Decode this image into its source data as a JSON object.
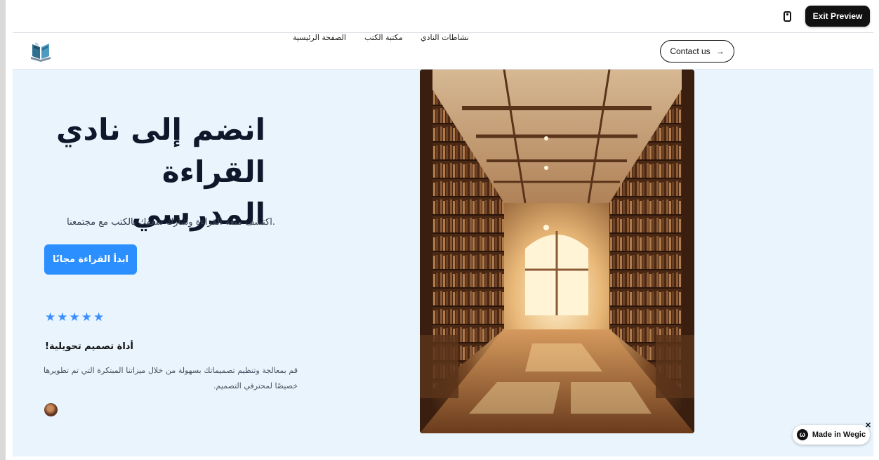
{
  "preview_bar": {
    "device_icon": "mobile-device-icon",
    "exit_label": "Exit Preview"
  },
  "nav": {
    "logo_icon": "open-book-logo",
    "links": [
      {
        "label": "الصفحة الرئيسية"
      },
      {
        "label": "مكتبة الكتب"
      },
      {
        "label": "نشاطات النادي"
      }
    ],
    "contact_label": "Contact us",
    "contact_arrow": "→"
  },
  "hero": {
    "title_line1": "انضم إلى نادي",
    "title_line2": "القراءة المدرسي",
    "subtitle": ".اكتشف متعة القراءة وشارك شغفك بالكتب مع مجتمعنا",
    "cta_label": "ابدأ القراءة مجانًا"
  },
  "review": {
    "rating": 5,
    "star_glyph": "★",
    "title": "!أداة تصميم تحويلية",
    "text": "قم بمعالجة وتنظيم تصميماتك بسهولة من خلال ميزاتنا المبتكرة التي تم تطويرها خصيصًا لمحترفي التصميم."
  },
  "badge": {
    "label": "Made in Wegic",
    "logo_glyph": "ω",
    "close_glyph": "✕"
  },
  "colors": {
    "accent": "#2b8fff",
    "star": "#3b8eff",
    "hero_bg": "#e9f4fd"
  }
}
